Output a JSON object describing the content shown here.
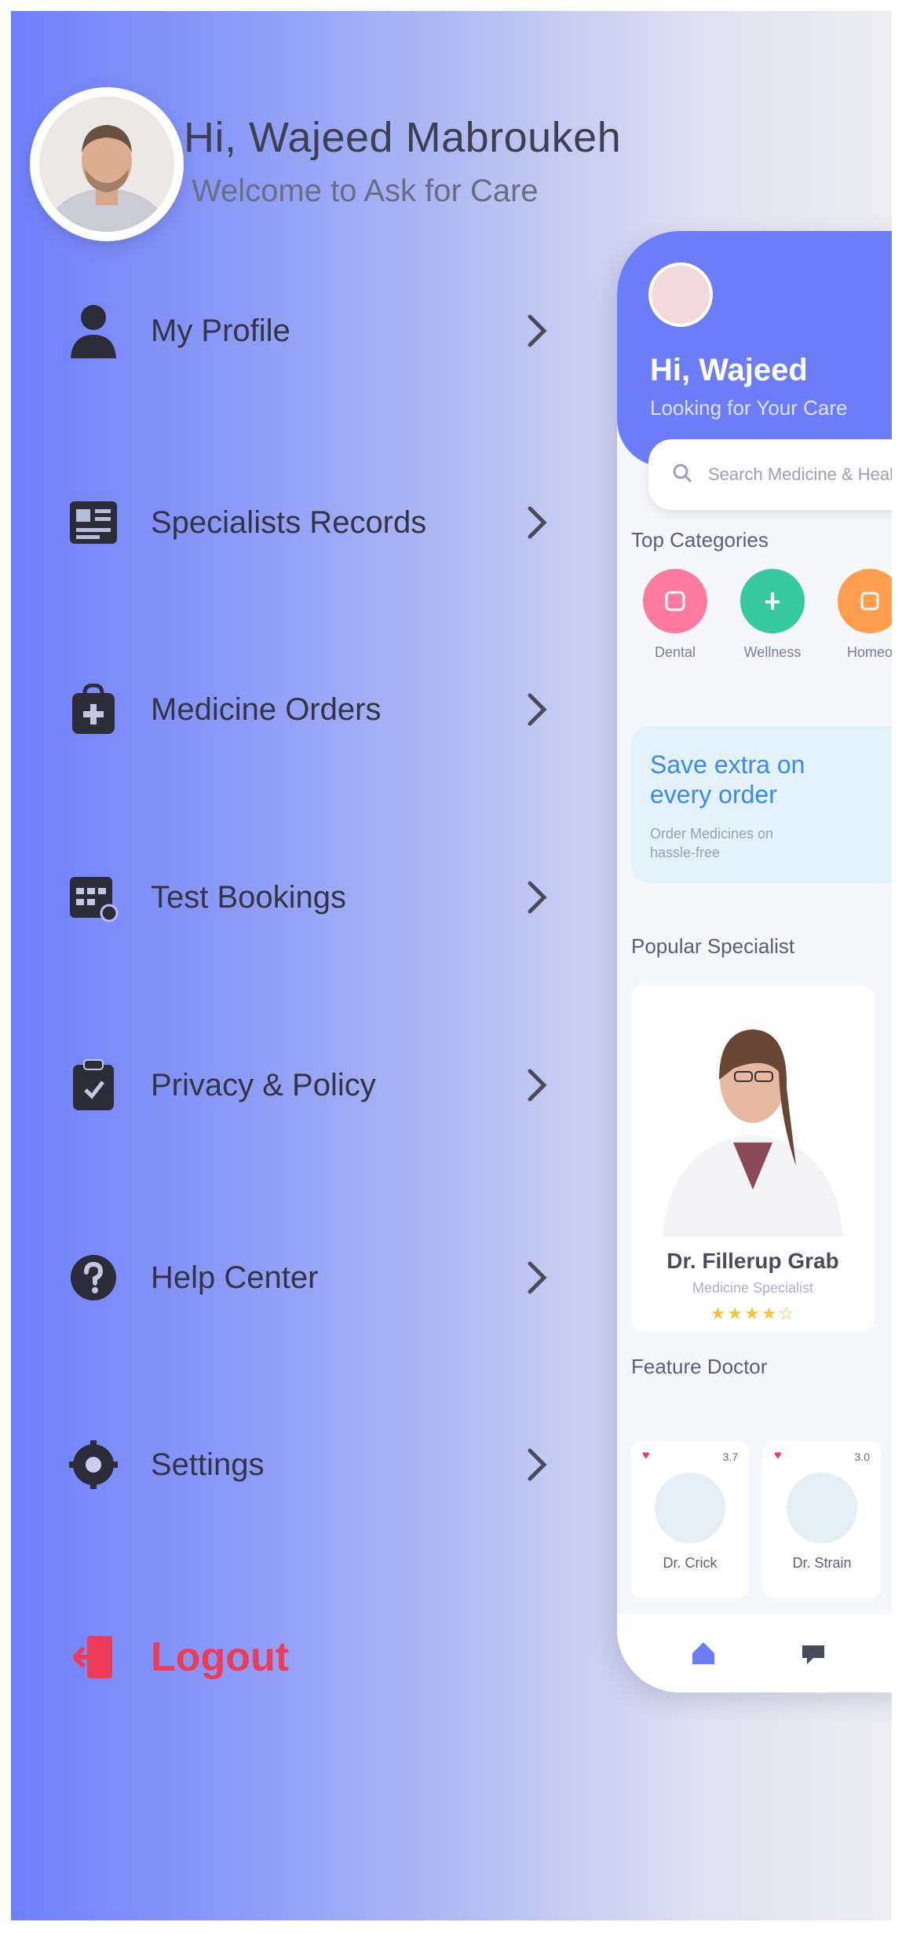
{
  "drawer": {
    "user_name": "Hi, Wajeed Mabroukeh",
    "welcome": "Welcome to Ask for Care",
    "items": [
      {
        "label": "My Profile",
        "icon": "user-icon"
      },
      {
        "label": "Specialists Records",
        "icon": "records-icon"
      },
      {
        "label": "Medicine Orders",
        "icon": "medicine-bag-icon"
      },
      {
        "label": "Test Bookings",
        "icon": "calendar-icon"
      },
      {
        "label": "Privacy & Policy",
        "icon": "clipboard-icon"
      },
      {
        "label": "Help Center",
        "icon": "help-icon"
      },
      {
        "label": "Settings",
        "icon": "gear-icon"
      }
    ],
    "logout_label": "Logout",
    "logout_icon": "logout-icon",
    "accent": "#6f80fb",
    "logout_color": "#ee3b57"
  },
  "preview": {
    "greeting": "Hi, Wajeed",
    "subtitle": "Looking for Your Care",
    "search_placeholder": "Search Medicine & Healthcare",
    "top_categories_title": "Top Categories",
    "categories": [
      {
        "label": "Dental",
        "color": "#ff7aa0"
      },
      {
        "label": "Wellness",
        "color": "#37c9a0"
      },
      {
        "label": "Homeo",
        "color": "#ff9e4f"
      }
    ],
    "promo_title": "Save extra on every order",
    "promo_sub": "Order Medicines on hassle-free",
    "popular_title": "Popular Specialist",
    "popular_doctor": {
      "name": "Dr. Fillerup Grab",
      "specialty": "Medicine Specialist",
      "stars": "★★★★☆"
    },
    "feature_title": "Feature Doctor",
    "feature_doctors": [
      {
        "name": "Dr. Crick",
        "rating": "3.7"
      },
      {
        "name": "Dr. Strain",
        "rating": "3.0"
      }
    ],
    "header_color": "#6b7df8"
  }
}
